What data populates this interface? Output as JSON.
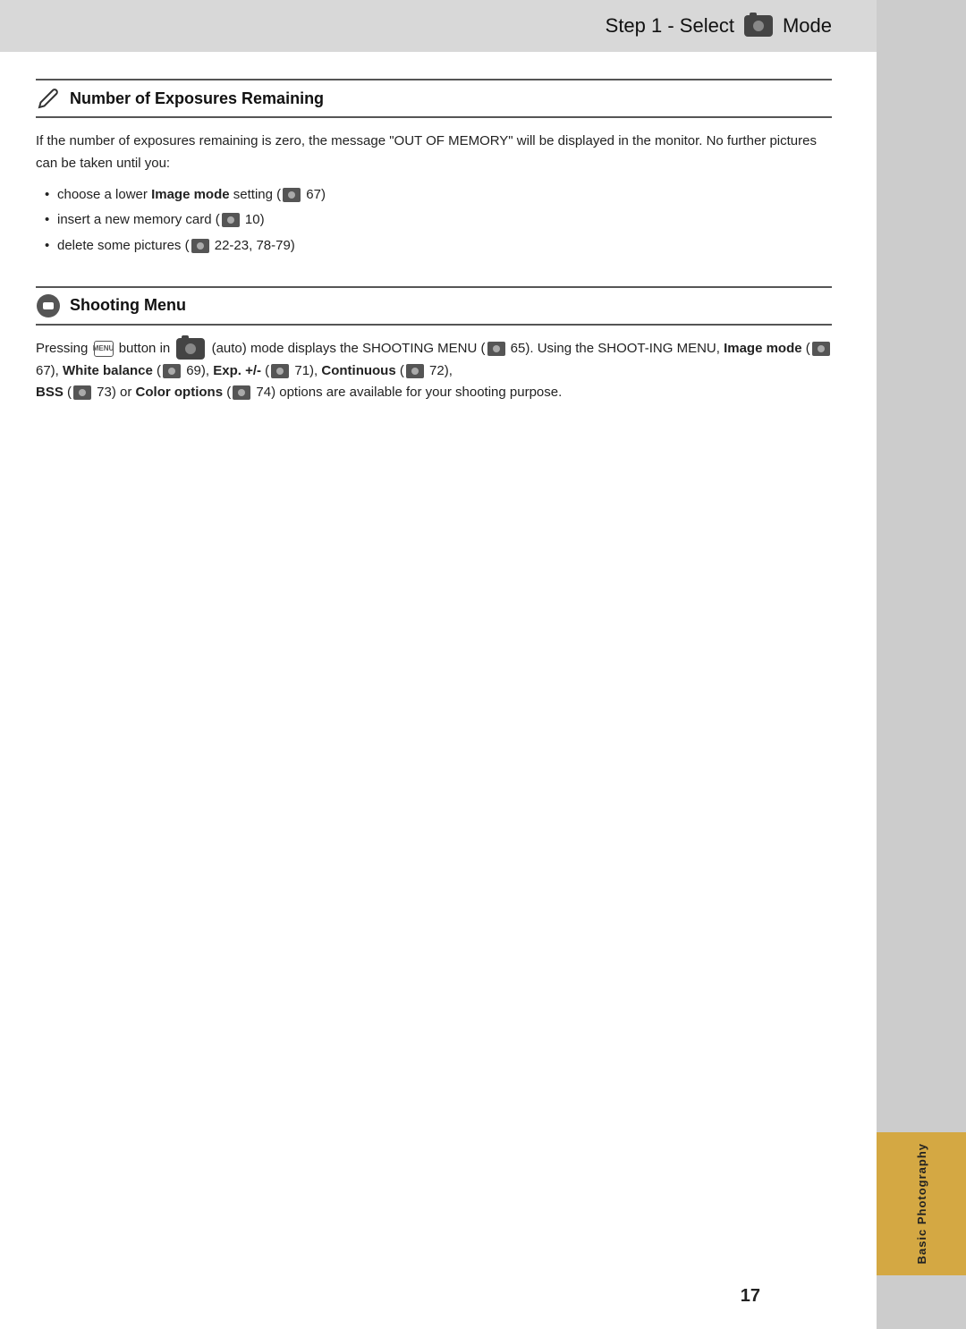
{
  "header": {
    "step": "Step 1 - Select",
    "icon_label": "camera",
    "mode": "Mode"
  },
  "sections": [
    {
      "id": "exposures",
      "icon": "pencil",
      "title": "Number of Exposures Remaining",
      "body": "If the number of exposures remaining is zero, the message \"OUT OF MEMORY\" will be displayed in the monitor. No further pictures can be taken until you:",
      "bullets": [
        "choose a lower Image mode setting (ref 67)",
        "insert a new memory card (ref 10)",
        "delete some pictures (ref 22-23, 78-79)"
      ]
    },
    {
      "id": "shooting",
      "icon": "gear-camera",
      "title": "Shooting Menu",
      "body_parts": [
        "Pressing",
        "menu_btn",
        "button in",
        "auto_cam",
        "(auto) mode displays the SHOOTING MENU (",
        "ref65",
        "65). Using the SHOOTING MENU,",
        "Image mode",
        "(",
        "ref67",
        "67),",
        "White balance",
        "(",
        "ref69",
        "69),",
        "Exp. +/-",
        " (",
        "ref71",
        "71),",
        "Continuous",
        "(",
        "ref72",
        "72),",
        "BSS",
        "(",
        "ref73",
        "73) or",
        "Color options",
        "(",
        "ref74",
        "74) options are available for your shooting purpose."
      ]
    }
  ],
  "page_number": "17",
  "right_tab_label": "Basic Photography"
}
